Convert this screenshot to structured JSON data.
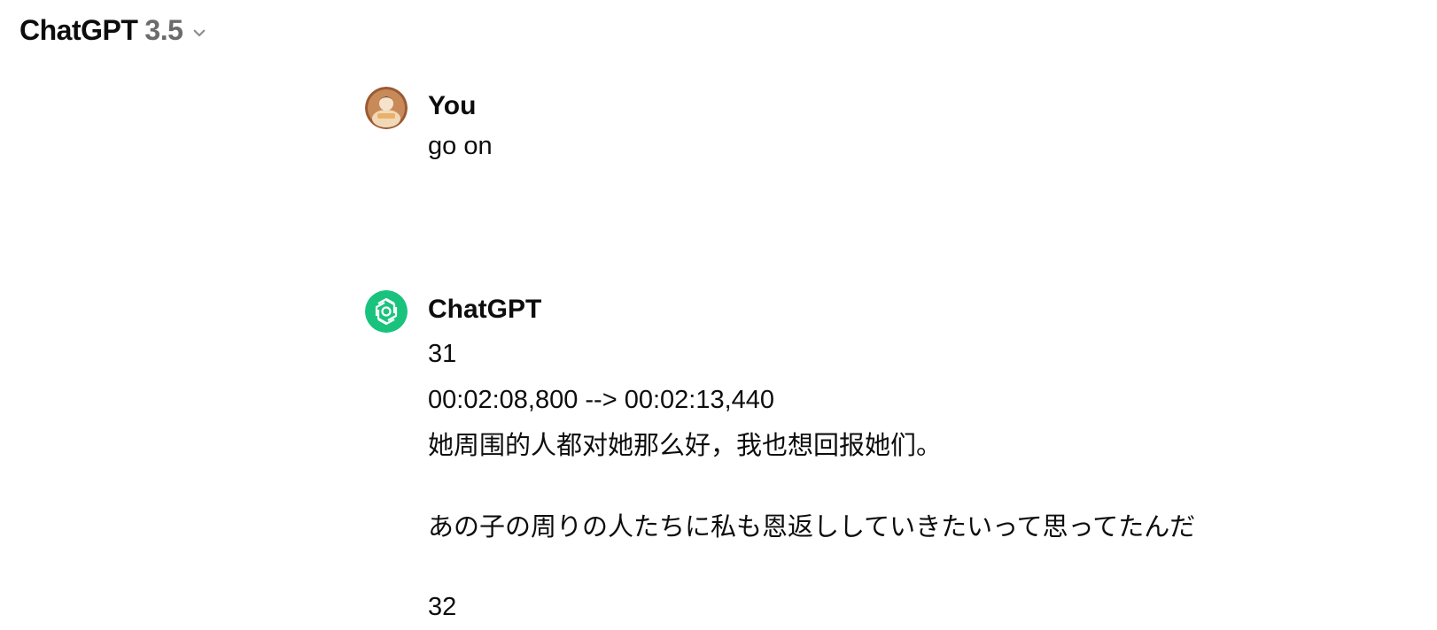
{
  "header": {
    "model_name": "ChatGPT",
    "model_version": "3.5",
    "chevron_icon": "chevron-down-icon"
  },
  "messages": [
    {
      "author": "You",
      "avatar_icon": "user-avatar",
      "lines": [
        "go on"
      ]
    },
    {
      "author": "ChatGPT",
      "avatar_icon": "openai-logo-icon",
      "avatar_color": "#19c37d",
      "lines": [
        "31",
        "00:02:08,800 --> 00:02:13,440",
        "她周围的人都对她那么好，我也想回报她们。",
        "",
        "あの子の周りの人たちに私も恩返ししていきたいって思ってたんだ",
        "",
        "32"
      ]
    }
  ]
}
